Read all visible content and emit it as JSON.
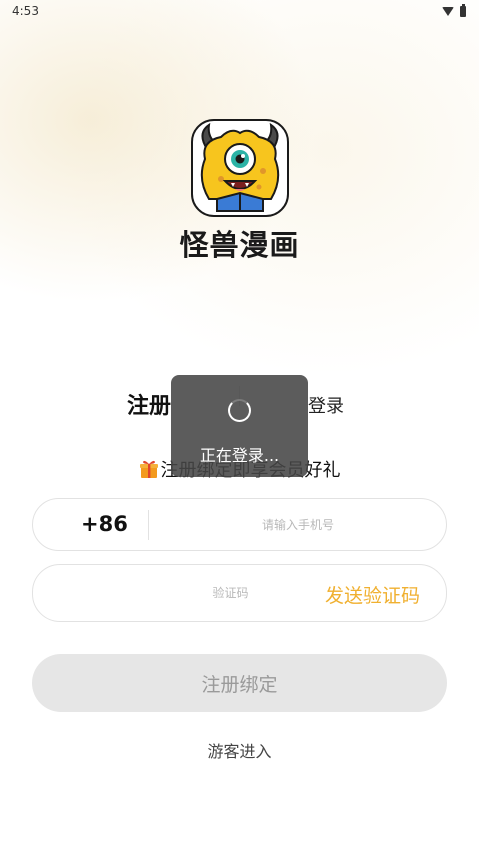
{
  "status_bar": {
    "time": "4:53"
  },
  "app": {
    "name": "怪兽漫画"
  },
  "tabs": {
    "register": "注册",
    "login": "登录"
  },
  "promo": {
    "text": "注册绑定即享会员好礼"
  },
  "phone": {
    "country_code": "+86",
    "placeholder": "请输入手机号"
  },
  "code": {
    "placeholder": "验证码",
    "send_label": "发送验证码"
  },
  "submit": {
    "label": "注册绑定"
  },
  "guest": {
    "label": "游客进入"
  },
  "loading": {
    "text": "正在登录..."
  },
  "colors": {
    "accent": "#f0b030",
    "disabled_bg": "#e6e6e6"
  },
  "icons": [
    "wifi-icon",
    "battery-icon",
    "app-logo",
    "gift-icon",
    "spinner-icon"
  ]
}
